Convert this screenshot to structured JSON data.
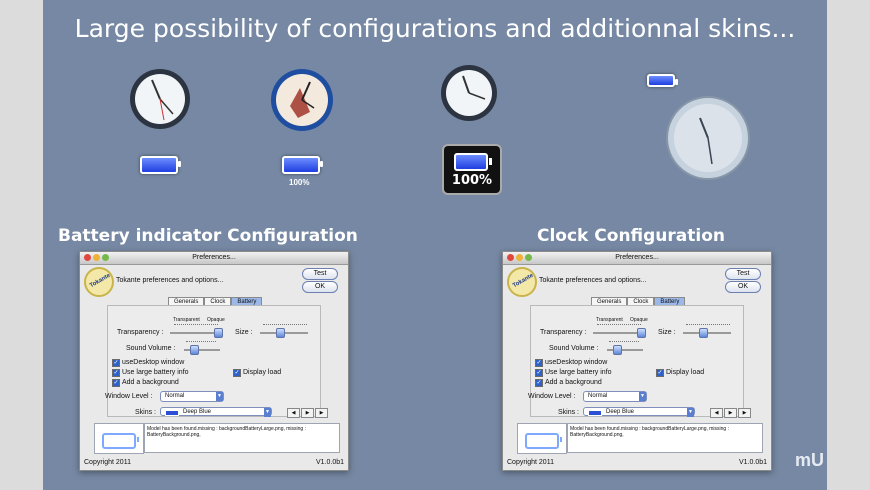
{
  "headline": "Large possibility of configurations and additionnal skins...",
  "samples": {
    "battery_percent_small": "100%",
    "battery_percent_large": "100%"
  },
  "sections": {
    "left_title": "Battery indicator Configuration",
    "right_title": "Clock Configuration"
  },
  "preferences": {
    "window_title": "Preferences...",
    "heading": "Tokante preferences and options...",
    "logo_text": "Tokante",
    "buttons": {
      "test": "Test",
      "ok": "OK"
    },
    "tabs": [
      "Generals",
      "Clock",
      "Battery"
    ],
    "transparency_label": "Transparency :",
    "transparent_label": "Transparent",
    "opaque_label": "Opaque",
    "size_label": "Size :",
    "sound_label": "Sound Volume :",
    "checkbox_desktop": "useDesktop window",
    "checkbox_large": "Use large battery info",
    "checkbox_bg": "Add a background",
    "checkbox_load": "Display load",
    "window_level_label": "Window Level :",
    "window_level_value": "Normal",
    "skins_label": "Skins :",
    "skins_value": "Deep Blue",
    "message": "Model has been found.missing : backgroundBatteryLarge.png, missing : BatteryBackground.png,",
    "copyright": "Copyright 2011",
    "version": "V1.0.0b1"
  },
  "watermark": "mU"
}
